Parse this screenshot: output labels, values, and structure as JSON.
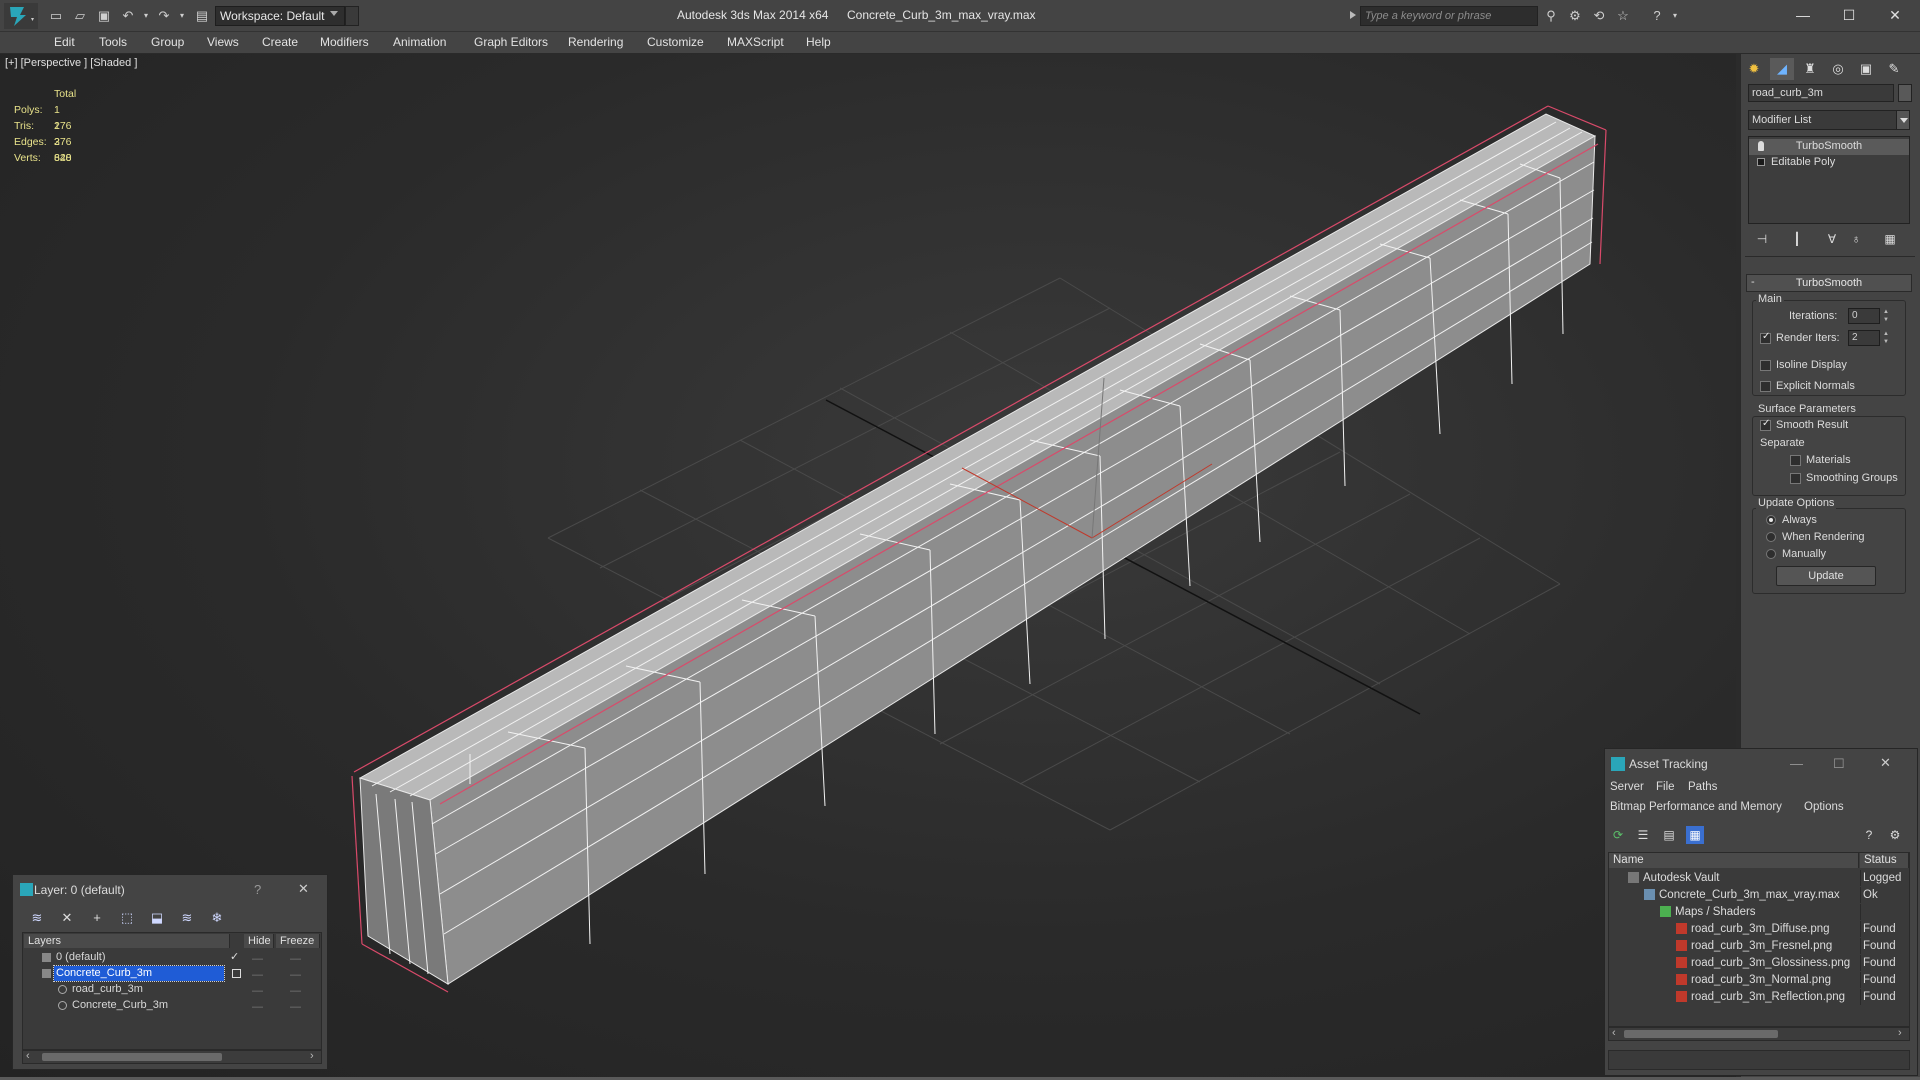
{
  "titlebar": {
    "workspace": "Workspace: Default",
    "app_title": "Autodesk 3ds Max  2014 x64",
    "file_title": "Concrete_Curb_3m_max_vray.max",
    "search_placeholder": "Type a keyword or phrase",
    "icons": [
      "new-file-icon",
      "open-file-icon",
      "save-icon",
      "undo-icon",
      "redo-icon",
      "project-folder-icon",
      "binoculars-icon",
      "search-tools-icon",
      "sync-icon",
      "star-icon",
      "help-icon"
    ]
  },
  "menu": [
    "Edit",
    "Tools",
    "Group",
    "Views",
    "Create",
    "Modifiers",
    "Animation",
    "Graph Editors",
    "Rendering",
    "Customize",
    "MAXScript",
    "Help"
  ],
  "viewport": {
    "label": "[+] [Perspective ] [Shaded ]",
    "stats": {
      "header": "Total",
      "rows": [
        {
          "label": "Polys:",
          "value": "1 276"
        },
        {
          "label": "Tris:",
          "value": "1 276"
        },
        {
          "label": "Edges:",
          "value": "3 828"
        },
        {
          "label": "Verts:",
          "value": "640"
        }
      ]
    },
    "background_color": "#2b2b2b",
    "stats_color": "#e8e28a"
  },
  "command_panel": {
    "object_name": "road_curb_3m",
    "modifier_list": "Modifier List",
    "stack": [
      "TurboSmooth",
      "Editable Poly"
    ],
    "rollout_title": "TurboSmooth",
    "main_group": "Main",
    "iterations_label": "Iterations:",
    "iterations_value": "0",
    "render_iters_label": "Render Iters:",
    "render_iters_value": "2",
    "render_iters_checked": true,
    "isoline_display": "Isoline Display",
    "explicit_normals": "Explicit Normals",
    "surface_params_group": "Surface Parameters",
    "smooth_result": "Smooth Result",
    "smooth_result_checked": true,
    "separate_label": "Separate",
    "materials": "Materials",
    "smoothing_groups": "Smoothing Groups",
    "update_options_group": "Update Options",
    "update_always": "Always",
    "update_when_rendering": "When Rendering",
    "update_manually": "Manually",
    "selected_update_option": "Always",
    "update_button": "Update"
  },
  "layer_dialog": {
    "title": "Layer: 0 (default)",
    "columns": [
      "Layers",
      "Hide",
      "Freeze"
    ],
    "rows": [
      {
        "name": "0 (default)",
        "indent": 1,
        "selected": false,
        "active": true
      },
      {
        "name": "Concrete_Curb_3m",
        "indent": 1,
        "selected": true,
        "active": false
      },
      {
        "name": "road_curb_3m",
        "indent": 2,
        "selected": false,
        "active": false
      },
      {
        "name": "Concrete_Curb_3m",
        "indent": 2,
        "selected": false,
        "active": false
      }
    ]
  },
  "asset_tracking": {
    "title": "Asset Tracking",
    "menus": [
      "Server",
      "File",
      "Paths",
      "Bitmap Performance and Memory",
      "Options"
    ],
    "columns": [
      "Name",
      "Status"
    ],
    "rows": [
      {
        "name": "Autodesk Vault",
        "status": "Logged O",
        "level": 1,
        "icon": "vault-icon"
      },
      {
        "name": "Concrete_Curb_3m_max_vray.max",
        "status": "Ok",
        "level": 2,
        "icon": "max-file-icon"
      },
      {
        "name": "Maps / Shaders",
        "status": "",
        "level": 3,
        "icon": "maps-folder-icon"
      },
      {
        "name": "road_curb_3m_Diffuse.png",
        "status": "Found",
        "level": 4,
        "icon": "png-file-icon"
      },
      {
        "name": "road_curb_3m_Fresnel.png",
        "status": "Found",
        "level": 4,
        "icon": "png-file-icon"
      },
      {
        "name": "road_curb_3m_Glossiness.png",
        "status": "Found",
        "level": 4,
        "icon": "png-file-icon"
      },
      {
        "name": "road_curb_3m_Normal.png",
        "status": "Found",
        "level": 4,
        "icon": "png-file-icon"
      },
      {
        "name": "road_curb_3m_Reflection.png",
        "status": "Found",
        "level": 4,
        "icon": "png-file-icon"
      }
    ]
  },
  "colors": {
    "accent_selection": "#1f5cd6",
    "ui_panel": "#444444",
    "teal_logo": "#2aa6b9"
  }
}
